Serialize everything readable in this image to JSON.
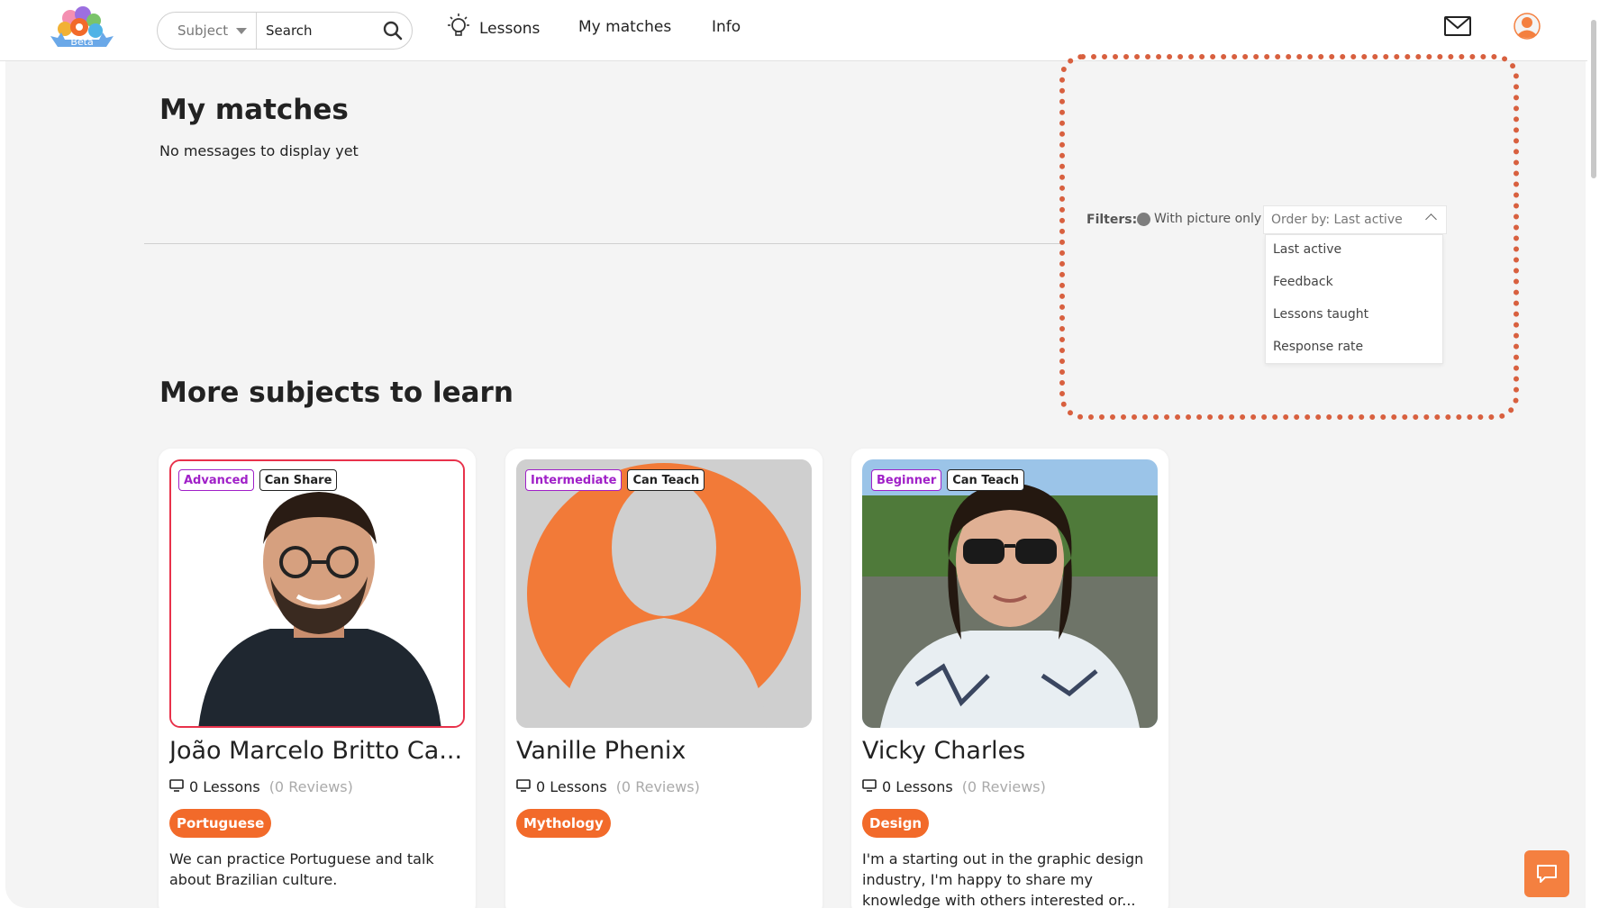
{
  "header": {
    "logo_text": "Beta",
    "search": {
      "subject_label": "Subject",
      "placeholder": "Search"
    },
    "nav": {
      "lessons": "Lessons",
      "my_matches": "My matches",
      "info": "Info"
    }
  },
  "matches": {
    "title": "My matches",
    "empty_message": "No messages to display yet"
  },
  "filters": {
    "label": "Filters:",
    "with_picture": "With picture only",
    "order_by": "Order by: Last active",
    "options": [
      "Last active",
      "Feedback",
      "Lessons taught",
      "Response rate"
    ]
  },
  "subjects": {
    "title": "More subjects to learn",
    "cards": [
      {
        "level": "Advanced",
        "role": "Can Share",
        "name": "João Marcelo Britto Ca...",
        "lessons": "0 Lessons",
        "reviews": "(0 Reviews)",
        "subject": "Portuguese",
        "bio": "We can practice Portuguese and talk about Brazilian culture."
      },
      {
        "level": "Intermediate",
        "role": "Can Teach",
        "name": "Vanille Phenix",
        "lessons": "0 Lessons",
        "reviews": "(0 Reviews)",
        "subject": "Mythology",
        "bio": ""
      },
      {
        "level": "Beginner",
        "role": "Can Teach",
        "name": "Vicky Charles",
        "lessons": "0 Lessons",
        "reviews": "(0 Reviews)",
        "subject": "Design",
        "bio": "I'm a starting out in the graphic design industry, I'm happy to share my knowledge with others interested or..."
      }
    ]
  },
  "colors": {
    "accent": "#f26a2a",
    "level_badge": "#a020c8",
    "highlight": "#d8603f"
  },
  "icons": [
    "search-icon",
    "lightbulb-icon",
    "mail-icon",
    "user-avatar-icon",
    "video-lesson-icon",
    "chat-icon"
  ]
}
